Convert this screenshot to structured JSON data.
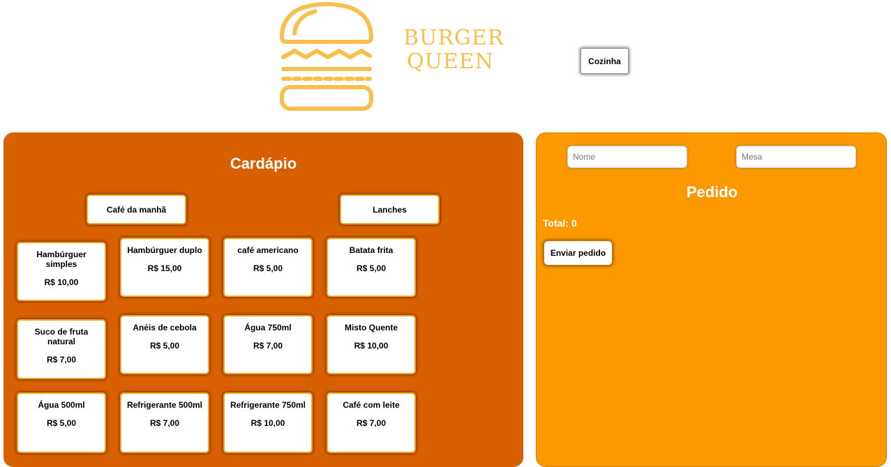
{
  "brand": {
    "name_line1": "BURGER",
    "name_line2": "QUEEN",
    "color": "#f9bf4c",
    "icon": "burger-icon"
  },
  "header": {
    "kitchen_label": "Cozinha"
  },
  "menu": {
    "title": "Cardápio",
    "categories": [
      {
        "label": "Café da manhã"
      },
      {
        "label": "Lanches"
      }
    ],
    "items": [
      {
        "name": "Hambúrguer simples",
        "price": "R$ 10,00"
      },
      {
        "name": "Hambúrguer duplo",
        "price": "R$ 15,00"
      },
      {
        "name": "café americano",
        "price": "R$ 5,00"
      },
      {
        "name": "Batata frita",
        "price": "R$ 5,00"
      },
      {
        "name": "Suco de fruta natural",
        "price": "R$ 7,00"
      },
      {
        "name": "Anéis de cebola",
        "price": "R$ 5,00"
      },
      {
        "name": "Água 750ml",
        "price": "R$ 7,00"
      },
      {
        "name": "Misto Quente",
        "price": "R$ 10,00"
      },
      {
        "name": "Água 500ml",
        "price": "R$ 5,00"
      },
      {
        "name": "Refrigerante 500ml",
        "price": "R$ 7,00"
      },
      {
        "name": "Refrigerante 750ml",
        "price": "R$ 10,00"
      },
      {
        "name": "Café com leite",
        "price": "R$ 7,00"
      }
    ]
  },
  "order": {
    "name_placeholder": "Nome",
    "name_value": "",
    "table_placeholder": "Mesa",
    "table_value": "",
    "title": "Pedido",
    "total_label": "Total: 0",
    "send_label": "Enviar pedido"
  },
  "colors": {
    "menu_panel": "#d86000",
    "order_panel": "#fc9900",
    "card_border": "#f6a623"
  }
}
